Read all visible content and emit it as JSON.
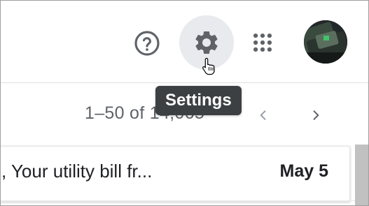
{
  "header": {
    "help_icon": "help-circle-icon",
    "settings_icon": "gear-icon",
    "apps_icon": "apps-grid-icon",
    "avatar_icon": "user-avatar"
  },
  "tooltip": {
    "text": "Settings"
  },
  "pagination": {
    "range_text": "1–50 of 14,065",
    "prev_icon": "chevron-left-icon",
    "next_icon": "chevron-right-icon"
  },
  "mail_list": {
    "rows": [
      {
        "snippet": ", Your utility bill fr...",
        "date": "May 5"
      }
    ]
  },
  "colors": {
    "icon_gray": "#5f6368",
    "settings_hover_bg": "#e8eaed",
    "tooltip_bg": "#3c4043",
    "scrollbar": "#c1c1c1"
  }
}
